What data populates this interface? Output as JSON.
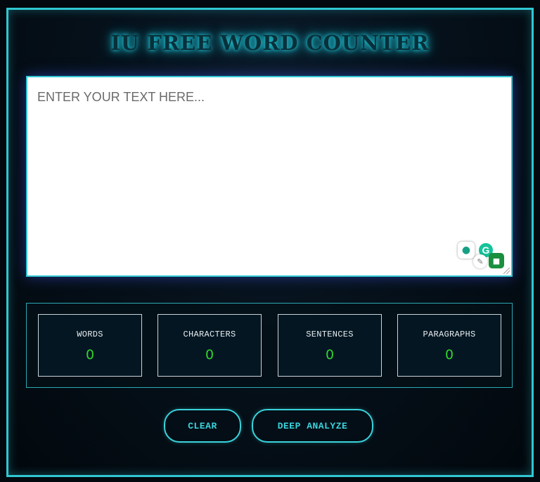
{
  "header": {
    "title": "IU FREE WORD COUNTER"
  },
  "editor": {
    "placeholder": "ENTER YOUR TEXT HERE...",
    "value": ""
  },
  "stats": [
    {
      "label": "WORDS",
      "value": "0"
    },
    {
      "label": "CHARACTERS",
      "value": "0"
    },
    {
      "label": "SENTENCES",
      "value": "0"
    },
    {
      "label": "PARAGRAPHS",
      "value": "0"
    }
  ],
  "actions": {
    "clear_label": "CLEAR",
    "deep_analyze_label": "DEEP ANALYZE"
  },
  "extension": {
    "icons": [
      "lightbulb-icon",
      "grammarly-icon",
      "pen-icon",
      "bot-icon"
    ],
    "grammarly_letter": "G"
  },
  "colors": {
    "accent": "#2fc7d3",
    "stat_value": "#32d22c",
    "background": "#02080d"
  }
}
